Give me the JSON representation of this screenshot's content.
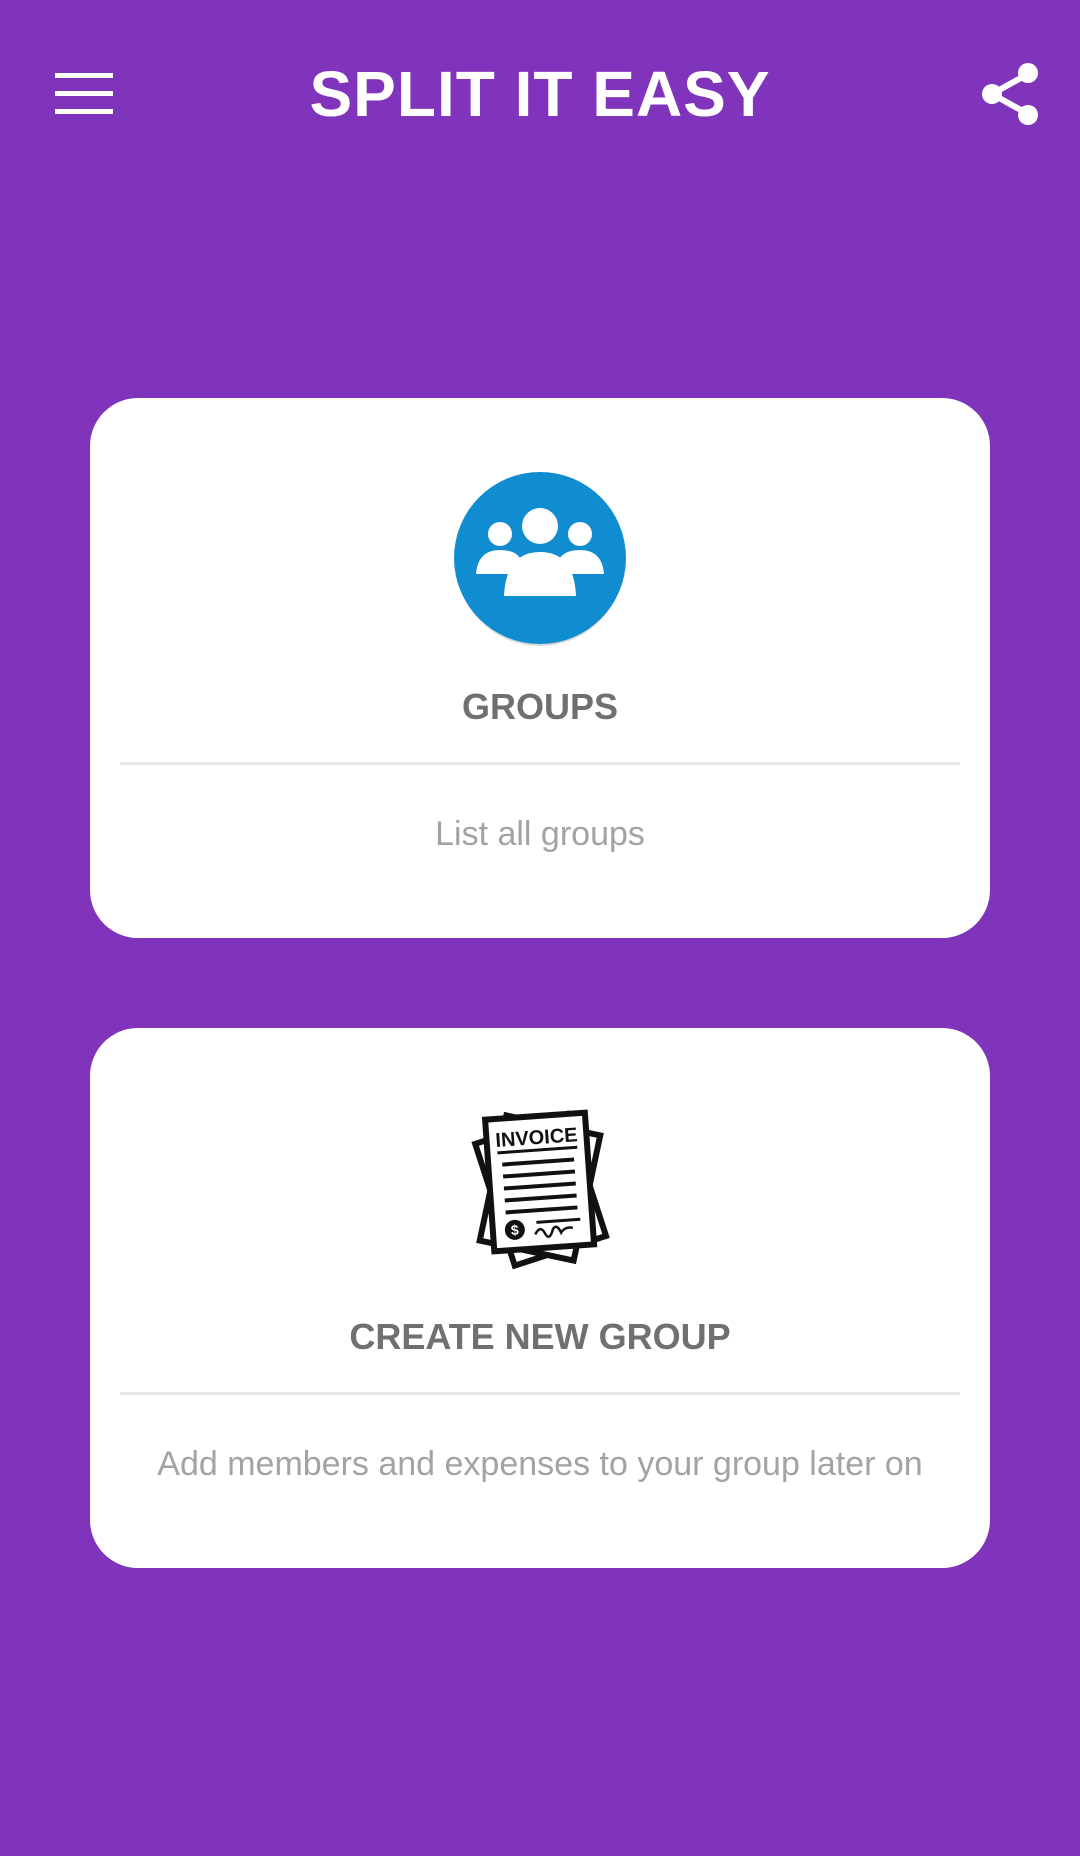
{
  "app_bar": {
    "title": "SPLIT IT EASY",
    "menu_icon": "hamburger-menu-icon",
    "share_icon": "share-icon"
  },
  "colors": {
    "background": "#8034bb",
    "card": "#ffffff",
    "groups_icon_bg": "#0f8dd0",
    "title_text": "#707070",
    "desc_text": "#a3a3a3"
  },
  "cards": [
    {
      "icon": "groups-icon",
      "title": "GROUPS",
      "description": "List all groups"
    },
    {
      "icon": "invoice-icon",
      "icon_text": "INVOICE",
      "title": "CREATE NEW GROUP",
      "description": "Add members and expenses to your group later on"
    }
  ]
}
